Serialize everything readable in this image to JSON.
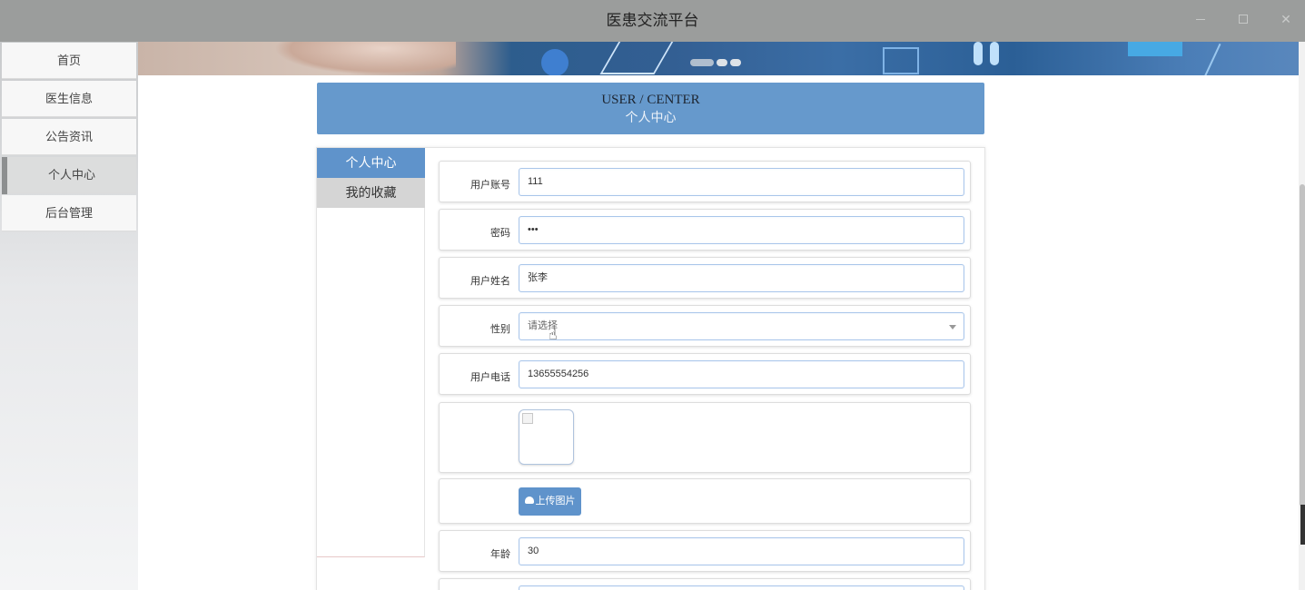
{
  "window": {
    "title": "医患交流平台"
  },
  "sidebar": {
    "items": [
      {
        "label": "首页"
      },
      {
        "label": "医生信息"
      },
      {
        "label": "公告资讯"
      },
      {
        "label": "个人中心",
        "active": true
      },
      {
        "label": "后台管理"
      }
    ]
  },
  "header": {
    "en_title": "USER / CENTER",
    "zh_title": "个人中心"
  },
  "subnav": {
    "items": [
      {
        "label": "个人中心",
        "active": true
      },
      {
        "label": "我的收藏"
      }
    ]
  },
  "form": {
    "account_label": "用户账号",
    "account_value": "111",
    "password_label": "密码",
    "password_value": "•••",
    "name_label": "用户姓名",
    "name_value": "张李",
    "gender_label": "性别",
    "gender_value": "请选择",
    "phone_label": "用户电话",
    "phone_value": "13655554256",
    "upload_label": "上传图片",
    "age_label": "年龄",
    "age_value": "30"
  },
  "colors": {
    "accent": "#6699cc",
    "titlebar": "#9b9d9c",
    "button": "#5f93cb"
  }
}
